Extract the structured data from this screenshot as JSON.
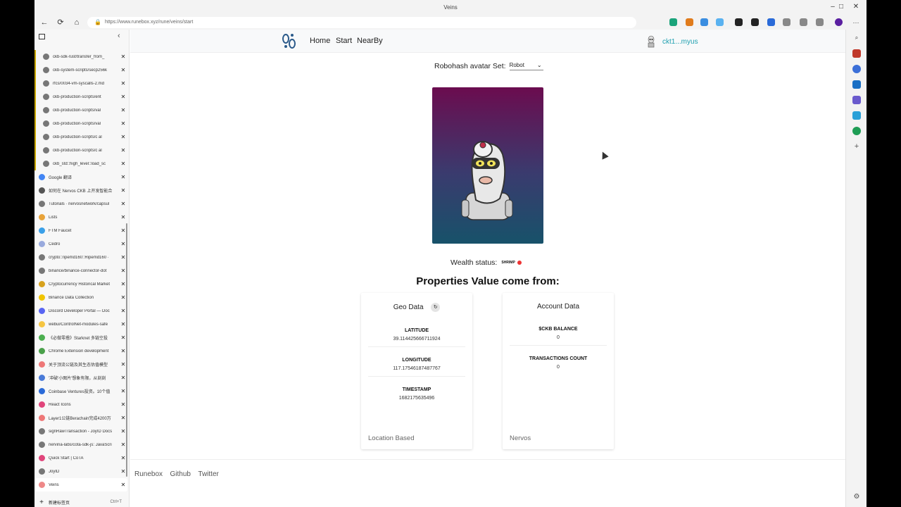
{
  "window": {
    "title": "Veins",
    "minimize": "–",
    "maximize": "□",
    "close": "✕"
  },
  "toolbar": {
    "back": "←",
    "refresh": "⟳",
    "home": "⌂",
    "url": "https://www.runebox.xyz/rune/veins/start",
    "menu": "···"
  },
  "sidebar": {
    "tabs": [
      {
        "label": "ckb-sdk-rust/transfer_from_",
        "icon": "github-icon",
        "grouped": true
      },
      {
        "label": "ckb-system-scripts/secp256k",
        "icon": "github-icon",
        "grouped": true
      },
      {
        "label": "rfcs/0034-vm-syscalls-2.md",
        "icon": "github-icon",
        "grouped": true
      },
      {
        "label": "ckb-production-scripts/ent",
        "icon": "github-icon",
        "grouped": true
      },
      {
        "label": "ckb-production-scripts/val",
        "icon": "github-icon",
        "grouped": true
      },
      {
        "label": "ckb-production-scripts/val",
        "icon": "github-icon",
        "grouped": true
      },
      {
        "label": "ckb-production-scripts/c al",
        "icon": "github-icon",
        "grouped": true
      },
      {
        "label": "ckb-production-scripts/c al",
        "icon": "github-icon",
        "grouped": true
      },
      {
        "label": "ckb_std::high_level::load_sc",
        "icon": "rust-icon",
        "grouped": true
      },
      {
        "label": "Google 翻译",
        "icon": "google-translate-icon",
        "grouped": false
      },
      {
        "label": "如何在 Nervos CKB 上开发智能合",
        "icon": "nervos-icon",
        "grouped": false
      },
      {
        "label": "Tutorials · nervosnetwork/capsul",
        "icon": "github-icon",
        "grouped": false
      },
      {
        "label": "Lists",
        "icon": "lists-icon",
        "grouped": false
      },
      {
        "label": "FTM Faucet",
        "icon": "fantom-icon",
        "grouped": false
      },
      {
        "label": "Cedro",
        "icon": "cedro-icon",
        "grouped": false
      },
      {
        "label": "crypto::ripemd160::Ripemd160 ·",
        "icon": "rust-icon",
        "grouped": false
      },
      {
        "label": "binance/binance-connector-dot",
        "icon": "github-icon",
        "grouped": false
      },
      {
        "label": "Cryptocurrency Historical Market",
        "icon": "chart-icon",
        "grouped": false
      },
      {
        "label": "Binance Data Collection",
        "icon": "binance-icon",
        "grouped": false
      },
      {
        "label": "Discord Developer Portal — Doc",
        "icon": "discord-icon",
        "grouped": false
      },
      {
        "label": "webui/ControlNet-modules-safe",
        "icon": "huggingface-icon",
        "grouped": false
      },
      {
        "label": "《必做零撸》Starknet 多链空投",
        "icon": "wechat-icon",
        "grouped": false
      },
      {
        "label": "Chrome Extension development",
        "icon": "chrome-icon",
        "grouped": false
      },
      {
        "label": "关于顶流公链及其生态估值模型",
        "icon": "doc-icon",
        "grouped": false
      },
      {
        "label": "'冲破'小图片'想象有限，从刻刻",
        "icon": "bookmark-icon",
        "grouped": false
      },
      {
        "label": "Coinbase Ventures投资。10个值",
        "icon": "coinbase-icon",
        "grouped": false
      },
      {
        "label": "React Icons",
        "icon": "react-icon",
        "grouped": false
      },
      {
        "label": "Layer1公链Berachain完成4200万",
        "icon": "doc-icon",
        "grouped": false
      },
      {
        "label": "signRawTransaction - JoyID Docs",
        "icon": "joyid-icon",
        "grouped": false
      },
      {
        "label": "nervina-labs/cota-sdk-js: JavaScri",
        "icon": "github-icon",
        "grouped": false
      },
      {
        "label": "Quick Start | CoTA",
        "icon": "cota-icon",
        "grouped": false
      },
      {
        "label": "JoyID",
        "icon": "joyid-icon",
        "grouped": false
      },
      {
        "label": "Veins",
        "icon": "veins-icon",
        "grouped": false,
        "active": true
      }
    ],
    "new_tab_label": "新建标签页",
    "new_tab_shortcut": "Ctrl+T"
  },
  "app": {
    "nav": {
      "home": "Home",
      "start": "Start",
      "nearby": "NearBy"
    },
    "user_address": "ckt1...myus",
    "avatar_set_label": "Robohash avatar Set:",
    "avatar_set_value": "Robot",
    "wealth_label": "Wealth status:",
    "wealth_badge": "SHRIMP",
    "properties_title": "Properties Value come from:",
    "geo": {
      "title": "Geo Data",
      "latitude_label": "LATITUDE",
      "latitude": "39.114425666711924",
      "longitude_label": "LONGITUDE",
      "longitude": "117.17546187487767",
      "timestamp_label": "TIMESTAMP",
      "timestamp": "1682175635496",
      "footer": "Location Based"
    },
    "account": {
      "title": "Account Data",
      "balance_label": "$CKB BALANCE",
      "balance": "0",
      "tx_label": "TRANSACTIONS COUNT",
      "tx": "0",
      "footer": "Nervos"
    },
    "footer_links": [
      "Runebox",
      "Github",
      "Twitter"
    ]
  },
  "colors": {
    "accent": "#1fa0b0",
    "card_top": "#6b0c4f",
    "card_bottom": "#17526a"
  }
}
